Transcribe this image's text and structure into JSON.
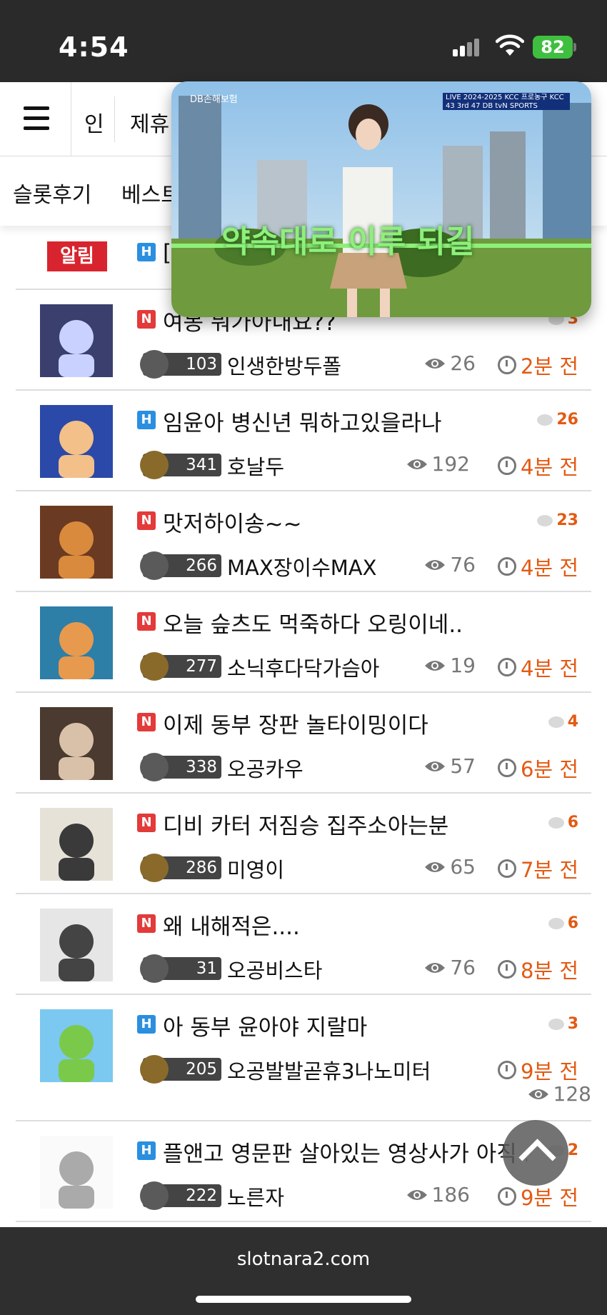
{
  "status": {
    "time": "4:54",
    "battery": "82"
  },
  "nav": {
    "item1": "인",
    "item2": "제휴"
  },
  "subnav": {
    "item1": "슬롯후기",
    "item2": "베스트"
  },
  "notice": {
    "badge": "알림",
    "title": "["
  },
  "pip": {
    "brand": "DB손해보험",
    "live": "LIVE 2024-2025 KCC 프로농구 KCC 43 3rd 47 DB tvN SPORTS",
    "caption": "약속대로 이루 되길"
  },
  "posts": [
    {
      "tag": "N",
      "title": "여봉 뭐가아내요??",
      "comments": "3",
      "level": "103",
      "author": "인생한방두폴",
      "views": "26",
      "time": "2분 전"
    },
    {
      "tag": "H",
      "title": "임윤아 병신년 뭐하고있을라나",
      "comments": "26",
      "level": "341",
      "author": "호날두",
      "views": "192",
      "time": "4분 전"
    },
    {
      "tag": "N",
      "title": "맛저하이송~~",
      "comments": "23",
      "level": "266",
      "author": "MAX장이수MAX",
      "views": "76",
      "time": "4분 전"
    },
    {
      "tag": "N",
      "title": "오늘 슾츠도 먹죽하다 오링이네..",
      "comments": "",
      "level": "277",
      "author": "소닉후다닥가슴아",
      "views": "19",
      "time": "4분 전"
    },
    {
      "tag": "N",
      "title": "이제 동부 장판 놀타이밍이다",
      "comments": "4",
      "level": "338",
      "author": "오공카우",
      "views": "57",
      "time": "6분 전"
    },
    {
      "tag": "N",
      "title": "디비 카터 저짐승 집주소아는분",
      "comments": "6",
      "level": "286",
      "author": "미영이",
      "views": "65",
      "time": "7분 전"
    },
    {
      "tag": "N",
      "title": "왜 내해적은....",
      "comments": "6",
      "level": "31",
      "author": "오공비스타",
      "views": "76",
      "time": "8분 전"
    },
    {
      "tag": "H",
      "title": "아 동부 윤아야 지랄마",
      "comments": "3",
      "level": "205",
      "author": "오공발발곧휴3나노미터",
      "views": "128",
      "time": "9분 전"
    },
    {
      "tag": "H",
      "title": "플앤고 영문판 살아있는 영상사가 아직 ...",
      "comments": "2",
      "level": "222",
      "author": "노른자",
      "views": "186",
      "time": "9분 전"
    }
  ],
  "browser": {
    "url": "slotnara2.com"
  }
}
